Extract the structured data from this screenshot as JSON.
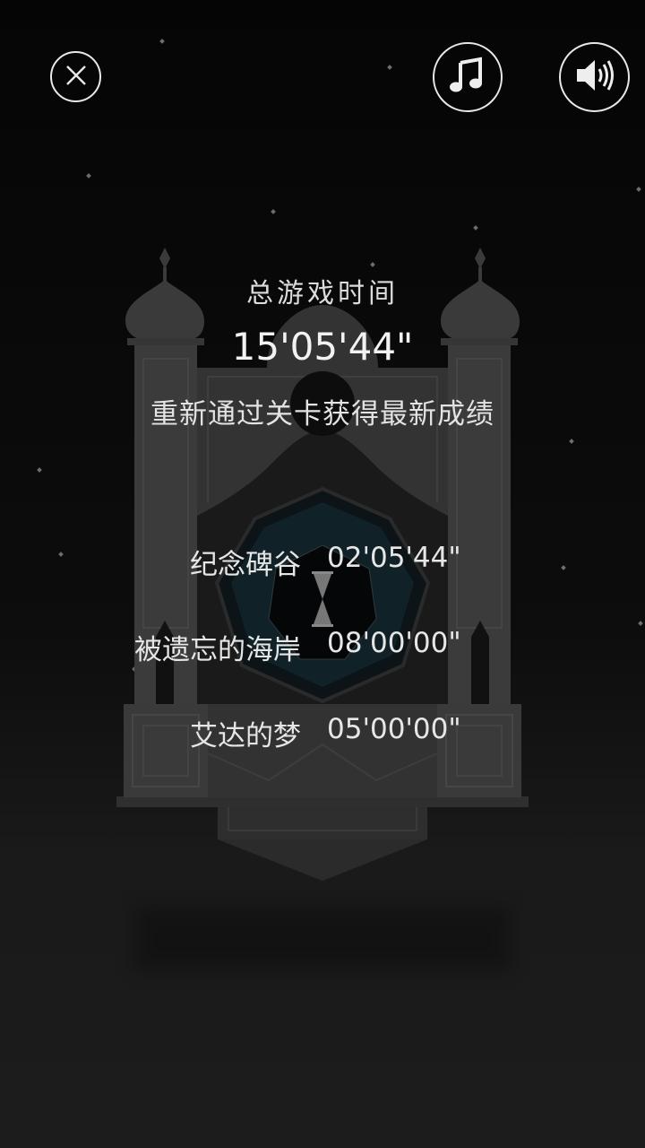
{
  "header": {
    "close_icon": "close-icon",
    "music_icon": "music-note-icon",
    "sound_icon": "speaker-volume-icon"
  },
  "summary": {
    "total_label": "总游戏时间",
    "total_time": "15'05'44\"",
    "hint": "重新通过关卡获得最新成绩"
  },
  "records": [
    {
      "name": "纪念碑谷",
      "time": "02'05'44\""
    },
    {
      "name": "被遗忘的海岸",
      "time": "08'00'00\""
    },
    {
      "name": "艾达的梦",
      "time": "05'00'00\""
    }
  ],
  "colors": {
    "background": "#0a0a0a",
    "building": "#3a3a3a",
    "text": "#e6e6e6",
    "button_border": "#e8e8e8"
  }
}
